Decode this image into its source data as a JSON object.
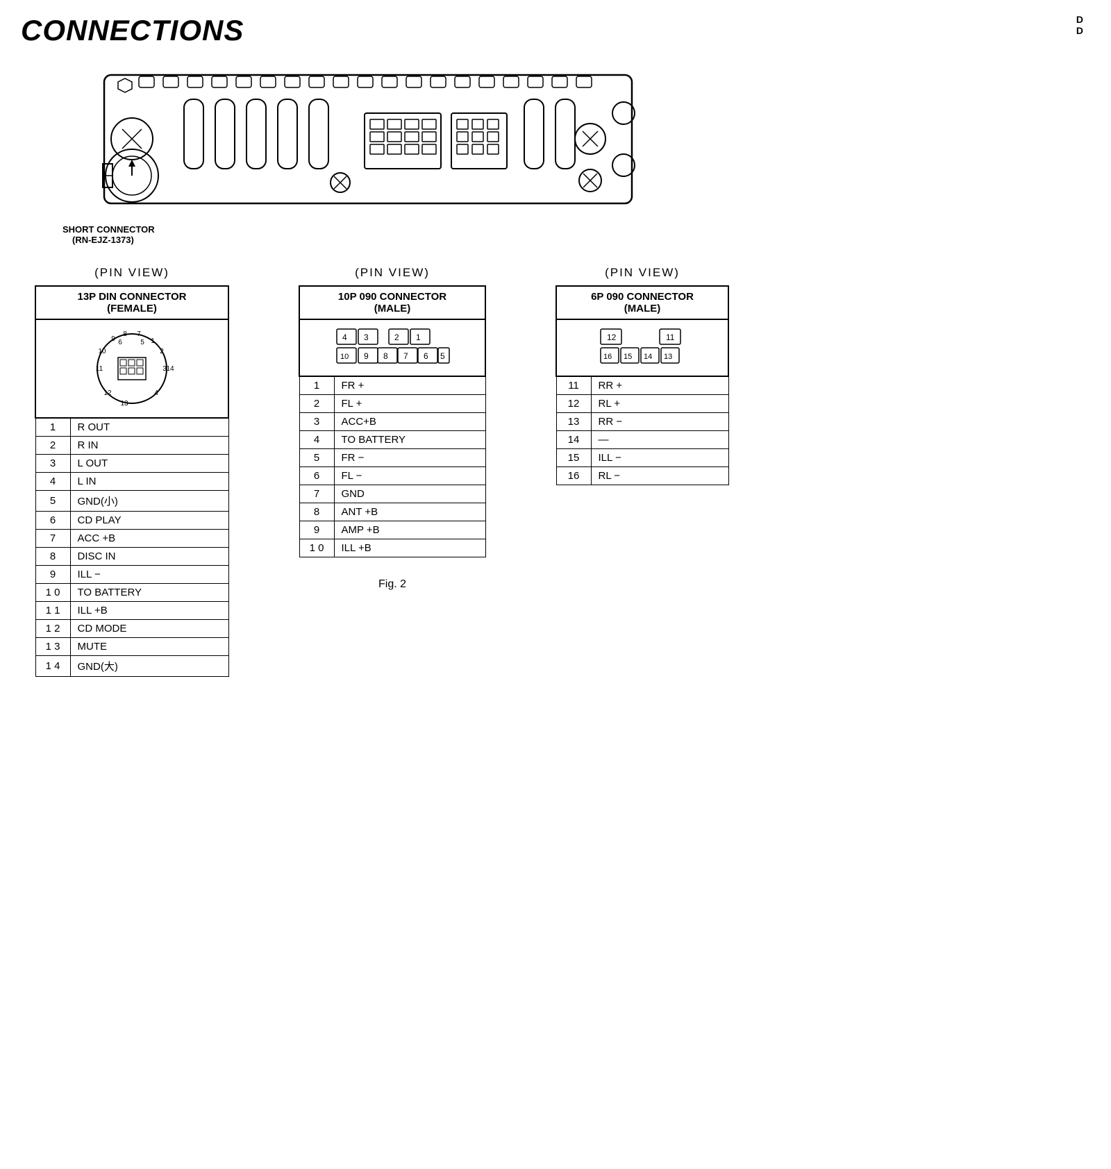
{
  "page": {
    "title": "CONNECTIONS",
    "top_right": "D\nD",
    "fig_label": "Fig. 2",
    "short_connector": {
      "label": "SHORT CONNECTOR",
      "part": "(RN-EJZ-1373)"
    }
  },
  "connector1": {
    "pin_view": "(PIN  VIEW)",
    "header_line1": "13P DIN CONNECTOR",
    "header_line2": "(FEMALE)",
    "pins": [
      {
        "num": "1",
        "label": "R OUT"
      },
      {
        "num": "2",
        "label": "R IN"
      },
      {
        "num": "3",
        "label": "L OUT"
      },
      {
        "num": "4",
        "label": "L IN"
      },
      {
        "num": "5",
        "label": "GND(小)"
      },
      {
        "num": "6",
        "label": "CD PLAY"
      },
      {
        "num": "7",
        "label": "ACC +B"
      },
      {
        "num": "8",
        "label": "DISC IN"
      },
      {
        "num": "9",
        "label": "ILL −"
      },
      {
        "num": "1 0",
        "label": "TO BATTERY"
      },
      {
        "num": "1 1",
        "label": "ILL +B"
      },
      {
        "num": "1 2",
        "label": "CD MODE"
      },
      {
        "num": "1 3",
        "label": "MUTE"
      },
      {
        "num": "1 4",
        "label": "GND(大)"
      }
    ]
  },
  "connector2": {
    "pin_view": "(PIN  VIEW)",
    "header_line1": "10P 090 CONNECTOR",
    "header_line2": "(MALE)",
    "pins": [
      {
        "num": "1",
        "label": "FR +"
      },
      {
        "num": "2",
        "label": "FL +"
      },
      {
        "num": "3",
        "label": "ACC+B"
      },
      {
        "num": "4",
        "label": "TO BATTERY"
      },
      {
        "num": "5",
        "label": "FR −"
      },
      {
        "num": "6",
        "label": "FL −"
      },
      {
        "num": "7",
        "label": "GND"
      },
      {
        "num": "8",
        "label": "ANT +B"
      },
      {
        "num": "9",
        "label": "AMP +B"
      },
      {
        "num": "1 0",
        "label": "ILL +B"
      }
    ]
  },
  "connector3": {
    "pin_view": "(PIN  VIEW)",
    "header_line1": "6P 090 CONNECTOR",
    "header_line2": "(MALE)",
    "pins": [
      {
        "num": "11",
        "label": "RR +"
      },
      {
        "num": "12",
        "label": "RL +"
      },
      {
        "num": "13",
        "label": "RR −"
      },
      {
        "num": "14",
        "label": "—"
      },
      {
        "num": "15",
        "label": "ILL −"
      },
      {
        "num": "16",
        "label": "RL −"
      }
    ]
  }
}
